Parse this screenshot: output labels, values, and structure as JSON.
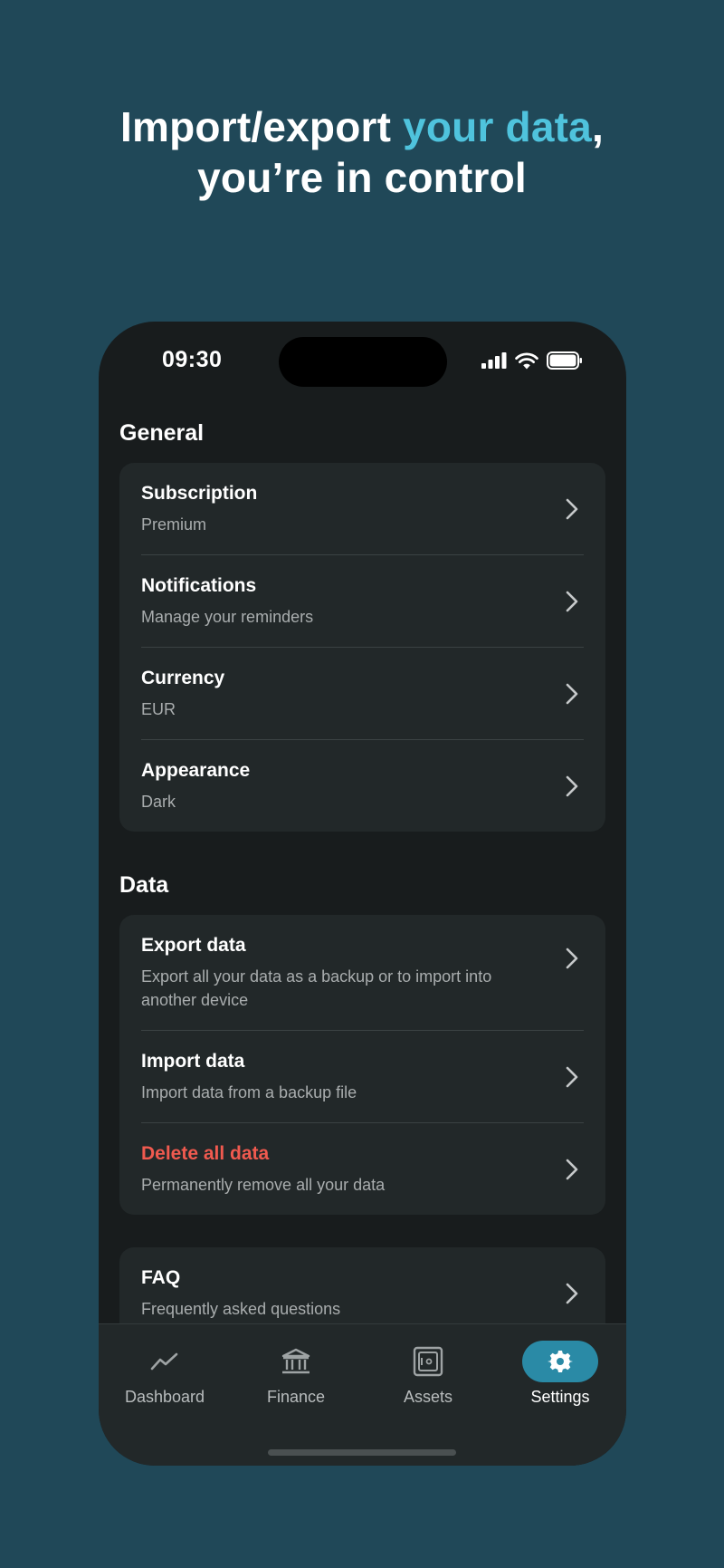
{
  "headline": {
    "line1_pre": "Import/export ",
    "line1_accent": "your data",
    "line1_post": ",",
    "line2": "you’re in control"
  },
  "status_bar": {
    "time": "09:30",
    "icons": [
      "signal-icon",
      "wifi-icon",
      "battery-icon"
    ]
  },
  "sections": {
    "general": {
      "title": "General",
      "items": [
        {
          "title": "Subscription",
          "subtitle": "Premium"
        },
        {
          "title": "Notifications",
          "subtitle": "Manage your reminders"
        },
        {
          "title": "Currency",
          "subtitle": "EUR"
        },
        {
          "title": "Appearance",
          "subtitle": "Dark"
        }
      ]
    },
    "data": {
      "title": "Data",
      "items": [
        {
          "title": "Export data",
          "subtitle": "Export all your data as a backup or to import into another device"
        },
        {
          "title": "Import data",
          "subtitle": "Import data from a backup file"
        },
        {
          "title": "Delete all data",
          "subtitle": "Permanently remove all your data"
        }
      ]
    },
    "help": {
      "items": [
        {
          "title": "FAQ",
          "subtitle": "Frequently asked questions"
        }
      ]
    }
  },
  "tabbar": {
    "items": [
      {
        "label": "Dashboard",
        "icon": "chart-line-icon"
      },
      {
        "label": "Finance",
        "icon": "bank-icon"
      },
      {
        "label": "Assets",
        "icon": "safe-icon"
      },
      {
        "label": "Settings",
        "icon": "gear-icon",
        "active": true
      }
    ]
  },
  "colors": {
    "background": "#204858",
    "accent": "#4fc3dd",
    "phone": "#181c1d",
    "card": "#222829",
    "danger": "#f05a4f",
    "active_tab": "#2a8aa6"
  }
}
